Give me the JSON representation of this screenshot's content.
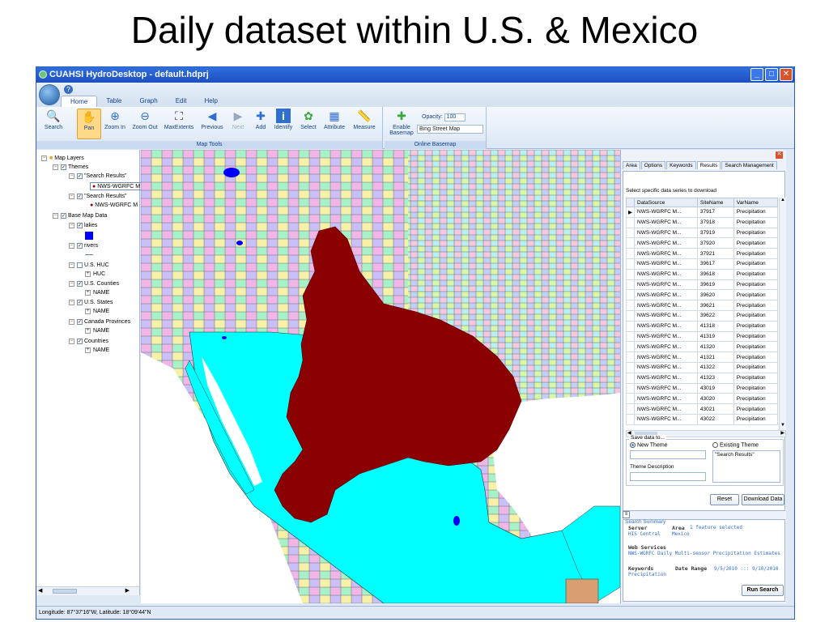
{
  "slide": {
    "title": "Daily dataset within U.S. & Mexico"
  },
  "window": {
    "title": "CUAHSI HydroDesktop - default.hdprj"
  },
  "ribbon": {
    "tabs": [
      "Home",
      "Table",
      "Graph",
      "Edit",
      "Help"
    ],
    "map_tools_label": "Map Tools",
    "online_basemap_label": "Online Basemap",
    "tools": {
      "search": "Search",
      "pan": "Pan",
      "zoom_in": "Zoom In",
      "zoom_out": "Zoom Out",
      "max_extents": "MaxExtents",
      "previous": "Previous",
      "next": "Next",
      "add": "Add",
      "identify": "Identify",
      "select": "Select",
      "attribute": "Attribute",
      "measure": "Measure",
      "enable_basemap": "Enable Basemap"
    },
    "opacity_label": "Opacity:",
    "opacity_value": "100",
    "basemap_value": "Bing Street Map"
  },
  "legend": {
    "root": "Map Layers",
    "themes": "Themes",
    "search_results_1": "\"Search Results\"",
    "nws_1": "NWS-WGRFC M",
    "search_results_2": "\"Search Results\"",
    "nws_2": "NWS-WGRFC M",
    "base_map_data": "Base Map Data",
    "lakes": "lakes",
    "rivers": "rivers",
    "us_huc": "U.S. HUC",
    "huc": "HUC",
    "us_counties": "U.S. Counties",
    "name1": "NAME",
    "us_states": "U.S. States",
    "name2": "NAME",
    "canada": "Canada Provinces",
    "name3": "NAME",
    "countries": "Countries",
    "name4": "NAME"
  },
  "search_panel": {
    "tabs": [
      "Area",
      "Options",
      "Keywords",
      "Results",
      "Search Management"
    ],
    "select_label": "Select specific data series to download",
    "columns": [
      "DataSource",
      "SiteName",
      "VarName"
    ],
    "rows": [
      [
        "NWS-WGRFC M...",
        "37917",
        "Precipitation"
      ],
      [
        "NWS-WGRFC M...",
        "37918",
        "Precipitation"
      ],
      [
        "NWS-WGRFC M...",
        "37919",
        "Precipitation"
      ],
      [
        "NWS-WGRFC M...",
        "37920",
        "Precipitation"
      ],
      [
        "NWS-WGRFC M...",
        "37921",
        "Precipitation"
      ],
      [
        "NWS-WGRFC M...",
        "39617",
        "Precipitation"
      ],
      [
        "NWS-WGRFC M...",
        "39618",
        "Precipitation"
      ],
      [
        "NWS-WGRFC M...",
        "39619",
        "Precipitation"
      ],
      [
        "NWS-WGRFC M...",
        "39620",
        "Precipitation"
      ],
      [
        "NWS-WGRFC M...",
        "39621",
        "Precipitation"
      ],
      [
        "NWS-WGRFC M...",
        "39622",
        "Precipitation"
      ],
      [
        "NWS-WGRFC M...",
        "41318",
        "Precipitation"
      ],
      [
        "NWS-WGRFC M...",
        "41319",
        "Precipitation"
      ],
      [
        "NWS-WGRFC M...",
        "41320",
        "Precipitation"
      ],
      [
        "NWS-WGRFC M...",
        "41321",
        "Precipitation"
      ],
      [
        "NWS-WGRFC M...",
        "41322",
        "Precipitation"
      ],
      [
        "NWS-WGRFC M...",
        "41323",
        "Precipitation"
      ],
      [
        "NWS-WGRFC M...",
        "43019",
        "Precipitation"
      ],
      [
        "NWS-WGRFC M...",
        "43020",
        "Precipitation"
      ],
      [
        "NWS-WGRFC M...",
        "43021",
        "Precipitation"
      ],
      [
        "NWS-WGRFC M...",
        "43022",
        "Precipitation"
      ]
    ],
    "save_data_to": "Save data to...",
    "new_theme": "New Theme",
    "existing_theme": "Existing Theme",
    "existing_theme_value": "\"Search Results\"",
    "theme_description": "Theme Description",
    "reset": "Reset",
    "download_data": "Download Data"
  },
  "summary": {
    "legend": "Search Summary",
    "server_label": "Server",
    "server_value": "HIS Central",
    "area_label": "Area",
    "area_value": "1 feature selected",
    "area_value2": "Mexico",
    "web_services_label": "Web Services",
    "web_services_value": "NWS-WGRFC Daily Multi-sensor Precipitation Estimates",
    "keywords_label": "Keywords",
    "keywords_value": "Precipitation",
    "date_range_label": "Date Range",
    "date_range_value": "9/5/2010 ::: 9/10/2010",
    "run_search": "Run Search"
  },
  "status": {
    "coords": "Longitude: 87°37'16\"W, Latitude: 18°09'44\"N"
  },
  "colors": {
    "highlight": "#8b0000",
    "mexico": "#00ffff",
    "ribbon": "#dfe9f5"
  }
}
